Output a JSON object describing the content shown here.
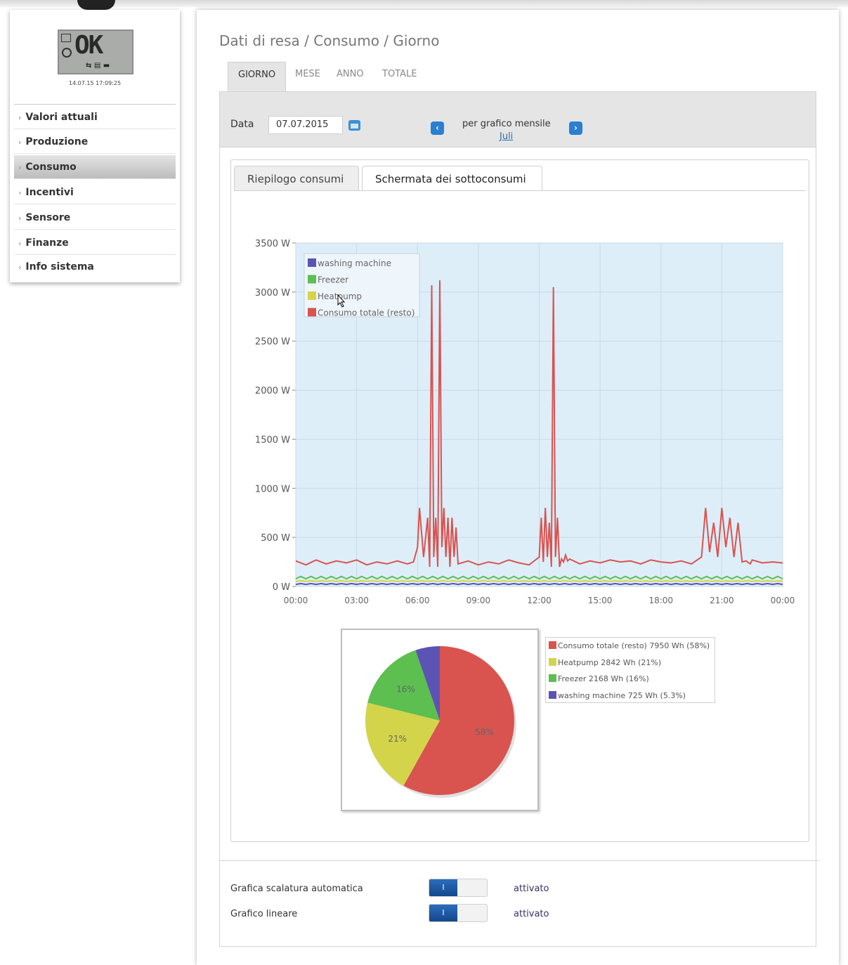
{
  "device": {
    "display_text": "OK",
    "timestamp": "14.07.15 17:09:25"
  },
  "sidebar": {
    "items": [
      {
        "label": "Valori attuali"
      },
      {
        "label": "Produzione"
      },
      {
        "label": "Consumo",
        "active": true
      },
      {
        "label": "Incentivi"
      },
      {
        "label": "Sensore"
      },
      {
        "label": "Finanze"
      },
      {
        "label": "Info sistema"
      }
    ]
  },
  "page": {
    "breadcrumb": "Dati di resa / Consumo / Giorno",
    "tabs": [
      {
        "label": "GIORNO",
        "active": true
      },
      {
        "label": "MESE"
      },
      {
        "label": "ANNO"
      },
      {
        "label": "TOTALE"
      }
    ]
  },
  "datebar": {
    "label": "Data",
    "value": "07.07.2015",
    "monthly_label": "per grafico mensile",
    "month_link": "Juli"
  },
  "subtabs": [
    {
      "label": "Riepilogo consumi"
    },
    {
      "label": "Schermata dei sottoconsumi",
      "active": true
    }
  ],
  "options": [
    {
      "label": "Grafica scalatura automatica",
      "toggle": "I",
      "value": "attivato"
    },
    {
      "label": "Grafico lineare",
      "toggle": "I",
      "value": "attivato"
    }
  ],
  "colors": {
    "red": "#d9534f",
    "yellow": "#d4d44a",
    "green": "#5cbf4f",
    "blue": "#5b54b4",
    "plot_bg": "#ddeef9",
    "accent": "#2a7fd0"
  },
  "chart_data": [
    {
      "type": "line",
      "x_ticks": [
        "00:00",
        "03:00",
        "06:00",
        "09:00",
        "12:00",
        "15:00",
        "18:00",
        "21:00",
        "00:00"
      ],
      "y_ticks": [
        "3500 W",
        "3000 W",
        "2500 W",
        "2000 W",
        "1500 W",
        "1000 W",
        "500 W",
        "0 W"
      ],
      "ylim": [
        0,
        3500
      ],
      "xlim_hours": [
        0,
        24
      ],
      "grid": true,
      "legend_position": "top-left",
      "legend": [
        "washing machine",
        "Freezer",
        "Heatpump",
        "Consumo totale (resto)"
      ],
      "series": [
        {
          "name": "washing machine",
          "color": "#5b54b4",
          "x": [
            0,
            24
          ],
          "y": [
            25,
            25
          ]
        },
        {
          "name": "Freezer",
          "color": "#5cbf4f",
          "x": [
            0,
            24
          ],
          "y": [
            90,
            90
          ]
        },
        {
          "name": "Heatpump",
          "color": "#d4d44a",
          "x": [
            0,
            24
          ],
          "y": [
            55,
            55
          ]
        },
        {
          "name": "Consumo totale (resto)",
          "color": "#d9534f",
          "x": [
            0,
            0.5,
            1,
            1.5,
            2,
            2.5,
            3,
            3.5,
            4,
            4.5,
            5,
            5.5,
            5.8,
            6.0,
            6.1,
            6.3,
            6.5,
            6.6,
            6.7,
            6.8,
            6.9,
            7.0,
            7.1,
            7.2,
            7.3,
            7.4,
            7.5,
            7.6,
            7.7,
            7.8,
            7.9,
            8.0,
            8.5,
            9,
            9.5,
            10,
            10.5,
            11,
            11.5,
            12,
            12.1,
            12.2,
            12.3,
            12.4,
            12.5,
            12.6,
            12.7,
            12.8,
            12.9,
            13.0,
            13.1,
            13.2,
            13.3,
            13.4,
            13.5,
            14,
            14.5,
            15,
            15.5,
            16,
            16.5,
            17,
            17.5,
            18,
            18.5,
            19,
            19.5,
            20,
            20.2,
            20.4,
            20.6,
            20.8,
            21.0,
            21.2,
            21.4,
            21.6,
            21.8,
            22.0,
            22.2,
            22.4,
            22.5,
            23,
            23.5,
            24
          ],
          "y": [
            260,
            220,
            270,
            230,
            260,
            240,
            270,
            220,
            250,
            230,
            260,
            230,
            250,
            400,
            800,
            300,
            700,
            200,
            3070,
            300,
            700,
            200,
            3120,
            400,
            800,
            300,
            700,
            200,
            700,
            300,
            600,
            230,
            260,
            220,
            250,
            230,
            270,
            240,
            220,
            300,
            700,
            250,
            800,
            300,
            650,
            200,
            3050,
            300,
            700,
            200,
            280,
            250,
            320,
            260,
            280,
            230,
            260,
            240,
            270,
            250,
            260,
            230,
            270,
            250,
            240,
            260,
            230,
            300,
            800,
            350,
            650,
            300,
            800,
            400,
            700,
            300,
            650,
            250,
            260,
            230,
            270,
            240,
            250,
            240
          ]
        }
      ]
    },
    {
      "type": "pie",
      "slices": [
        {
          "label": "Consumo totale (resto)",
          "value_wh": 7950,
          "percent": 58,
          "label_text": "58%",
          "legend_text": "Consumo totale (resto) 7950 Wh (58%)",
          "color": "#d9534f"
        },
        {
          "label": "Heatpump",
          "value_wh": 2842,
          "percent": 21,
          "label_text": "21%",
          "legend_text": "Heatpump 2842 Wh (21%)",
          "color": "#d4d44a"
        },
        {
          "label": "Freezer",
          "value_wh": 2168,
          "percent": 16,
          "label_text": "16%",
          "legend_text": "Freezer 2168 Wh (16%)",
          "color": "#5cbf4f"
        },
        {
          "label": "washing machine",
          "value_wh": 725,
          "percent": 5.3,
          "label_text": "",
          "legend_text": "washing machine 725 Wh (5.3%)",
          "color": "#5b54b4"
        }
      ]
    }
  ]
}
